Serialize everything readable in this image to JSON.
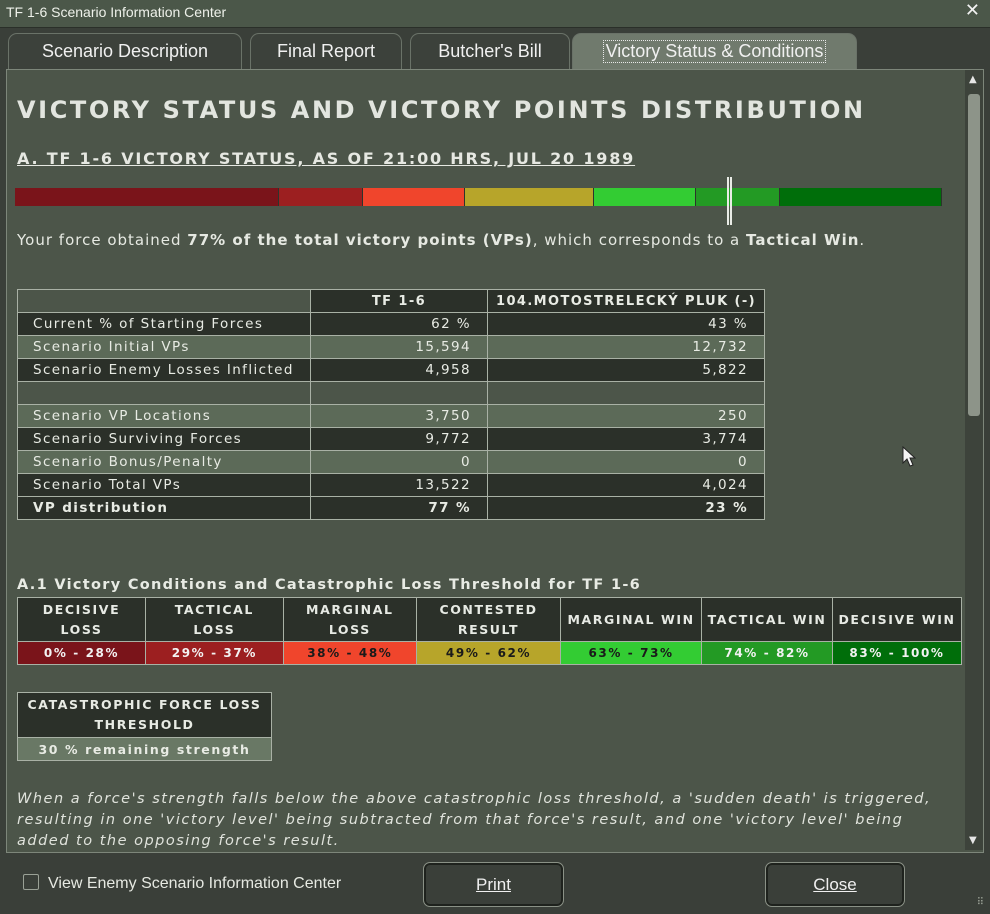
{
  "window": {
    "title": "TF 1-6 Scenario Information Center",
    "close_glyph": "✕"
  },
  "tabs": [
    {
      "label": "Scenario Description"
    },
    {
      "label": "Final Report"
    },
    {
      "label": "Butcher's Bill"
    },
    {
      "label": "Victory Status & Conditions"
    }
  ],
  "main": {
    "heading": "VICTORY STATUS AND VICTORY POINTS DISTRIBUTION",
    "status_title": "A. TF 1-6 VICTORY STATUS, AS OF 21:00 HRS, JUL 20 1989",
    "progress": {
      "value_percent": 77
    },
    "summary": {
      "prefix": "Your force obtained ",
      "bold1": "77% of the total victory points (VPs)",
      "middle": ", which corresponds to a ",
      "bold2": "Tactical Win",
      "suffix": "."
    },
    "vp_table": {
      "headers": [
        "",
        "TF 1-6",
        "104.MOTOSTRELECKÝ PLUK (-)"
      ],
      "rows": [
        {
          "label": "Current % of Starting Forces",
          "a": "62 %",
          "b": "43 %"
        },
        {
          "label": "Scenario Initial VPs",
          "a": "15,594",
          "b": "12,732"
        },
        {
          "label": "Scenario Enemy Losses Inflicted",
          "a": "4,958",
          "b": "5,822"
        },
        {
          "label": "",
          "a": "",
          "b": ""
        },
        {
          "label": "Scenario VP Locations",
          "a": "3,750",
          "b": "250"
        },
        {
          "label": "Scenario Surviving Forces",
          "a": "9,772",
          "b": "3,774"
        },
        {
          "label": "Scenario Bonus/Penalty",
          "a": "0",
          "b": "0"
        },
        {
          "label": "Scenario Total VPs",
          "a": "13,522",
          "b": "4,024"
        },
        {
          "label": "VP distribution",
          "a": "77 %",
          "b": "23 %"
        }
      ]
    },
    "conditions_title": "A.1 Victory Conditions and Catastrophic Loss Threshold for TF 1-6",
    "conditions": [
      {
        "line1": "DECISIVE",
        "line2": "LOSS",
        "range": "0% - 28%",
        "color": "#7a141a"
      },
      {
        "line1": "TACTICAL",
        "line2": "LOSS",
        "range": "29% - 37%",
        "color": "#9c1f20"
      },
      {
        "line1": "MARGINAL",
        "line2": "LOSS",
        "range": "38% - 48%",
        "color": "#f0452c"
      },
      {
        "line1": "CONTESTED",
        "line2": "RESULT",
        "range": "49% - 62%",
        "color": "#b7a52a"
      },
      {
        "line1": "MARGINAL WIN",
        "line2": "",
        "range": "63% - 73%",
        "color": "#33cc33"
      },
      {
        "line1": "TACTICAL WIN",
        "line2": "",
        "range": "74% - 82%",
        "color": "#239a24"
      },
      {
        "line1": "DECISIVE WIN",
        "line2": "",
        "range": "83% - 100%",
        "color": "#006e0a"
      }
    ],
    "catastrophic": {
      "line1": "CATASTROPHIC FORCE LOSS",
      "line2": "THRESHOLD",
      "value": "30 % remaining strength"
    },
    "note": "When a force's strength falls below the above catastrophic loss threshold, a 'sudden death' is triggered, resulting in one 'victory level' being subtracted from that force's result, and one 'victory level' being added to the opposing force's result."
  },
  "footer": {
    "checkbox_label": "View Enemy Scenario Information Center",
    "print_label": "Print",
    "close_label": "Close"
  }
}
